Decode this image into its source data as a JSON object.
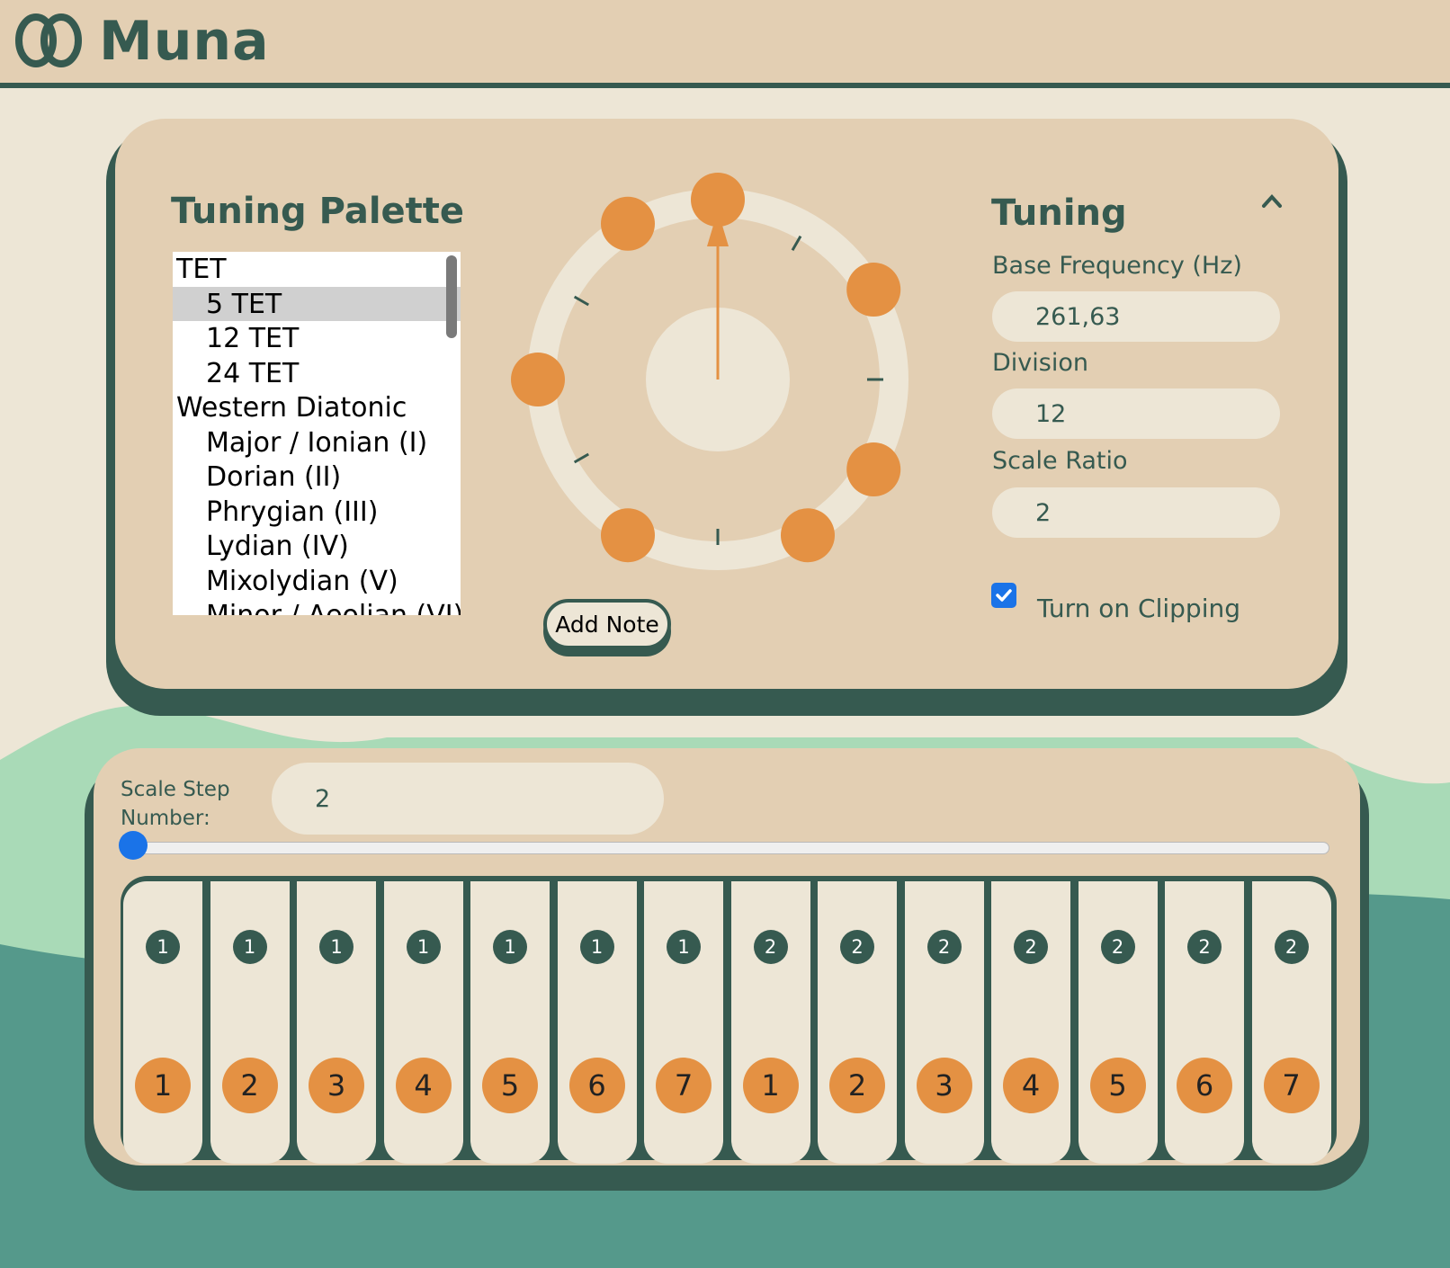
{
  "app": {
    "title": "Muna"
  },
  "colors": {
    "dark_green": "#365a50",
    "tan": "#e3cfb3",
    "cream": "#ede6d6",
    "orange": "#e49143",
    "light_green": "#a9dab7",
    "teal": "#55998b",
    "checkbox_blue": "#1a73e8"
  },
  "palette": {
    "title": "Tuning Palette",
    "items": [
      {
        "label": "TET",
        "indent": false,
        "selected": false
      },
      {
        "label": "5 TET",
        "indent": true,
        "selected": true
      },
      {
        "label": "12 TET",
        "indent": true,
        "selected": false
      },
      {
        "label": "24 TET",
        "indent": true,
        "selected": false
      },
      {
        "label": "Western Diatonic",
        "indent": false,
        "selected": false
      },
      {
        "label": "Major / Ionian (I)",
        "indent": true,
        "selected": false
      },
      {
        "label": "Dorian (II)",
        "indent": true,
        "selected": false
      },
      {
        "label": "Phrygian (III)",
        "indent": true,
        "selected": false
      },
      {
        "label": "Lydian (IV)",
        "indent": true,
        "selected": false
      },
      {
        "label": "Mixolydian (V)",
        "indent": true,
        "selected": false
      },
      {
        "label": "Minor / Aeolian (VI)",
        "indent": true,
        "selected": false
      }
    ]
  },
  "wheel": {
    "division": 12,
    "active_steps": [
      0,
      2,
      4,
      5,
      7,
      9,
      11
    ],
    "pointer_step": 0
  },
  "add_note": {
    "label": "Add Note"
  },
  "tuning": {
    "title": "Tuning",
    "collapse_icon": "chevron-up-icon",
    "base_frequency": {
      "label": "Base Frequency (Hz)",
      "value": "261,63"
    },
    "division": {
      "label": "Division",
      "value": "12"
    },
    "scale_ratio": {
      "label": "Scale Ratio",
      "value": "2"
    },
    "clipping": {
      "label": "Turn on Clipping",
      "checked": true
    }
  },
  "keyboard": {
    "step_label": "Scale Step Number:",
    "step_value": "2",
    "slider_value": 0,
    "keys": [
      {
        "octave": "1",
        "degree": "1"
      },
      {
        "octave": "1",
        "degree": "2"
      },
      {
        "octave": "1",
        "degree": "3"
      },
      {
        "octave": "1",
        "degree": "4"
      },
      {
        "octave": "1",
        "degree": "5"
      },
      {
        "octave": "1",
        "degree": "6"
      },
      {
        "octave": "1",
        "degree": "7"
      },
      {
        "octave": "2",
        "degree": "1"
      },
      {
        "octave": "2",
        "degree": "2"
      },
      {
        "octave": "2",
        "degree": "3"
      },
      {
        "octave": "2",
        "degree": "4"
      },
      {
        "octave": "2",
        "degree": "5"
      },
      {
        "octave": "2",
        "degree": "6"
      },
      {
        "octave": "2",
        "degree": "7"
      }
    ]
  }
}
